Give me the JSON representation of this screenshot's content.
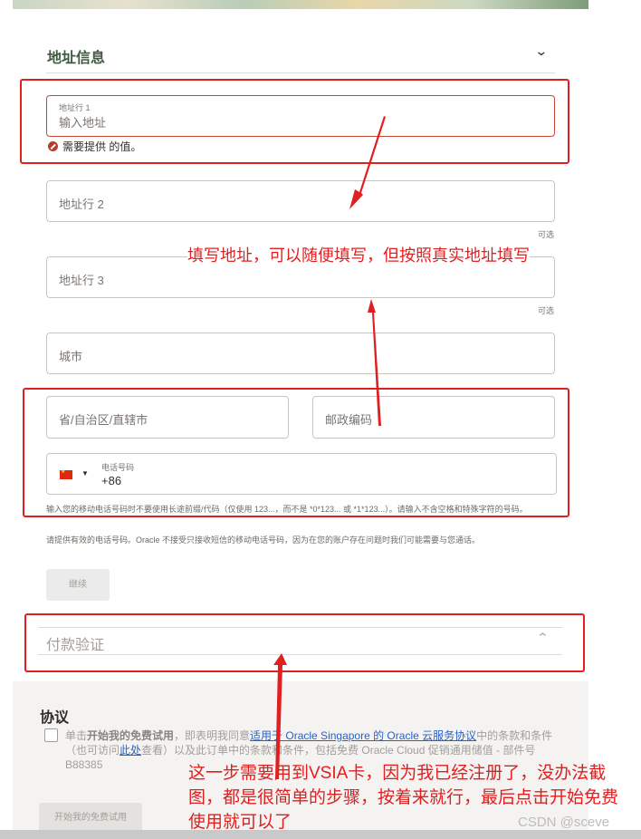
{
  "address_section": {
    "title": "地址信息",
    "address1": {
      "label": "地址行 1",
      "placeholder": "输入地址",
      "error": "需要提供 的值。"
    },
    "address2": {
      "placeholder": "地址行 2",
      "optional": "可选"
    },
    "address3": {
      "placeholder": "地址行 3",
      "optional": "可选"
    },
    "city": {
      "placeholder": "城市"
    },
    "province": {
      "placeholder": "省/自治区/直辖市"
    },
    "postal": {
      "placeholder": "邮政编码"
    },
    "phone": {
      "label": "电话号码",
      "value": "+86",
      "country": "china-flag-icon"
    },
    "phone_hint": "输入您的移动电话号码时不要使用长途前缀/代码（仅使用 123...，而不是 *0*123... 或 *1*123...）。请输入不含空格和特殊字符的号码。",
    "phone_notice": "请提供有效的电话号码。Oracle 不接受只接收短信的移动电话号码，因为在您的账户存在问题时我们可能需要与您通话。",
    "continue_label": "继续"
  },
  "payment_section": {
    "title": "付款验证"
  },
  "agreement": {
    "title": "协议",
    "text_1": "单击",
    "text_bold": "开始我的免费试用",
    "text_2": "，即表明我同意",
    "link_1": "适用于 Oracle Singapore 的 Oracle 云服务协议",
    "text_3": "中的条款和条件（也可访问",
    "link_2": "此处",
    "text_4": "查看）以及此订单中的条款和条件，包括免费 Oracle Cloud 促销通用储值 - 部件号B88385",
    "start_label": "开始我的免费试用"
  },
  "annotations": {
    "address_note": "填写地址，可以随便填写，但按照真实地址填写",
    "payment_note": "这一步需要用到VSIA卡，因为我已经注册了，没办法截图，都是很简单的步骤，按着来就行，最后点击开始免费使用就可以了"
  },
  "watermark": "CSDN @sceve",
  "colors": {
    "annotation_red": "#e02020",
    "section_green": "#3f5a3c",
    "error_red": "#c74634",
    "link_blue": "#2a62c4"
  }
}
